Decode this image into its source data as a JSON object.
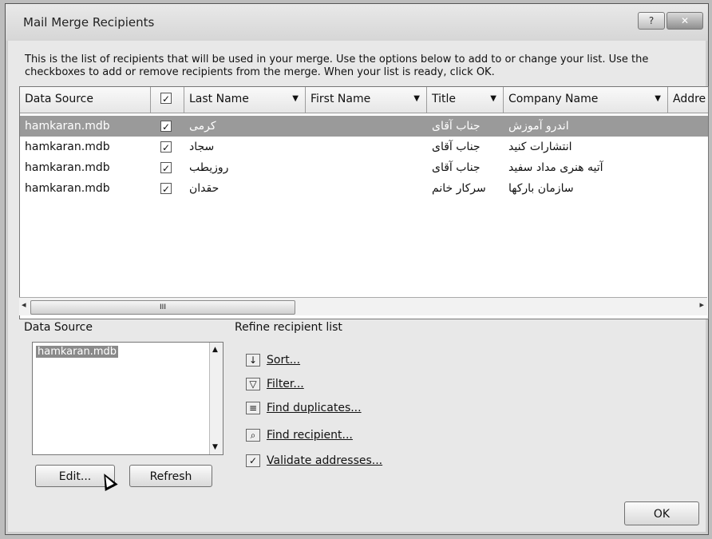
{
  "window": {
    "title": "Mail Merge Recipients",
    "help_label": "?",
    "close_label": "✕"
  },
  "description": "This is the list of recipients that will be used in your merge. Use the options below to add to or change your list. Use the checkboxes to add or remove recipients from the merge. When your list is ready, click OK.",
  "table": {
    "columns": [
      "Data Source",
      "Last Name",
      "First Name",
      "Title",
      "Company Name",
      "Addre"
    ],
    "header_checkbox": "✓",
    "rows": [
      {
        "source": "hamkaran.mdb",
        "checked": "✓",
        "last_name": "کرمی",
        "first_name": "",
        "title": "جناب آقای",
        "company": "اندرو آموزش",
        "selected": true
      },
      {
        "source": "hamkaran.mdb",
        "checked": "✓",
        "last_name": "سجاد",
        "first_name": "",
        "title": "جناب آقای",
        "company": "انتشارات کنید",
        "selected": false
      },
      {
        "source": "hamkaran.mdb",
        "checked": "✓",
        "last_name": "روزیطب",
        "first_name": "",
        "title": "جناب آقای",
        "company": "آتیه هنری مداد سفید",
        "selected": false
      },
      {
        "source": "hamkaran.mdb",
        "checked": "✓",
        "last_name": "حقدان",
        "first_name": "",
        "title": "سرکار خانم",
        "company": "سازمان بارکها",
        "selected": false
      }
    ],
    "scroll_grip": "III"
  },
  "data_source": {
    "label": "Data Source",
    "items": [
      "hamkaran.mdb"
    ],
    "edit_label": "Edit...",
    "refresh_label": "Refresh"
  },
  "refine": {
    "label": "Refine recipient list",
    "items": [
      {
        "label": "Sort...",
        "icon": "sort-icon"
      },
      {
        "label": "Filter...",
        "icon": "filter-icon"
      },
      {
        "label": "Find duplicates...",
        "icon": "duplicates-icon"
      },
      {
        "label": "Find recipient...",
        "icon": "find-recipient-icon"
      },
      {
        "label": "Validate addresses...",
        "icon": "validate-icon"
      }
    ]
  },
  "ok_label": "OK"
}
